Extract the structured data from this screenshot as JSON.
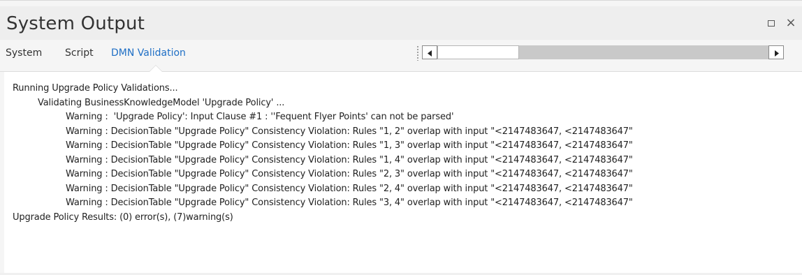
{
  "window": {
    "title": "System Output",
    "maximize_icon": "maximize-icon",
    "close_icon": "close-icon",
    "close_glyph": "×"
  },
  "tabs": [
    {
      "label": "System",
      "active": false
    },
    {
      "label": "Script",
      "active": false
    },
    {
      "label": "DMN Validation",
      "active": true
    }
  ],
  "colors": {
    "active_tab": "#1f6fc5",
    "panel_bg": "#f5f5f5",
    "output_bg": "#ffffff"
  },
  "scrollbar": {
    "left_arrow": "◀",
    "right_arrow": "▶"
  },
  "output": {
    "lines": [
      {
        "indent": 0,
        "text": "Running Upgrade Policy Validations..."
      },
      {
        "indent": 1,
        "text": "Validating BusinessKnowledgeModel 'Upgrade Policy' ..."
      },
      {
        "indent": 2,
        "text": "Warning :  'Upgrade Policy': Input Clause #1 : ''Fequent Flyer Points' can not be parsed'"
      },
      {
        "indent": 2,
        "text": "Warning : DecisionTable \"Upgrade Policy\" Consistency Violation: Rules \"1, 2\" overlap with input \"<2147483647, <2147483647\""
      },
      {
        "indent": 2,
        "text": "Warning : DecisionTable \"Upgrade Policy\" Consistency Violation: Rules \"1, 3\" overlap with input \"<2147483647, <2147483647\""
      },
      {
        "indent": 2,
        "text": "Warning : DecisionTable \"Upgrade Policy\" Consistency Violation: Rules \"1, 4\" overlap with input \"<2147483647, <2147483647\""
      },
      {
        "indent": 2,
        "text": "Warning : DecisionTable \"Upgrade Policy\" Consistency Violation: Rules \"2, 3\" overlap with input \"<2147483647, <2147483647\""
      },
      {
        "indent": 2,
        "text": "Warning : DecisionTable \"Upgrade Policy\" Consistency Violation: Rules \"2, 4\" overlap with input \"<2147483647, <2147483647\""
      },
      {
        "indent": 2,
        "text": "Warning : DecisionTable \"Upgrade Policy\" Consistency Violation: Rules \"3, 4\" overlap with input \"<2147483647, <2147483647\""
      },
      {
        "indent": 0,
        "text": "Upgrade Policy Results: (0) error(s), (7)warning(s)"
      }
    ]
  }
}
